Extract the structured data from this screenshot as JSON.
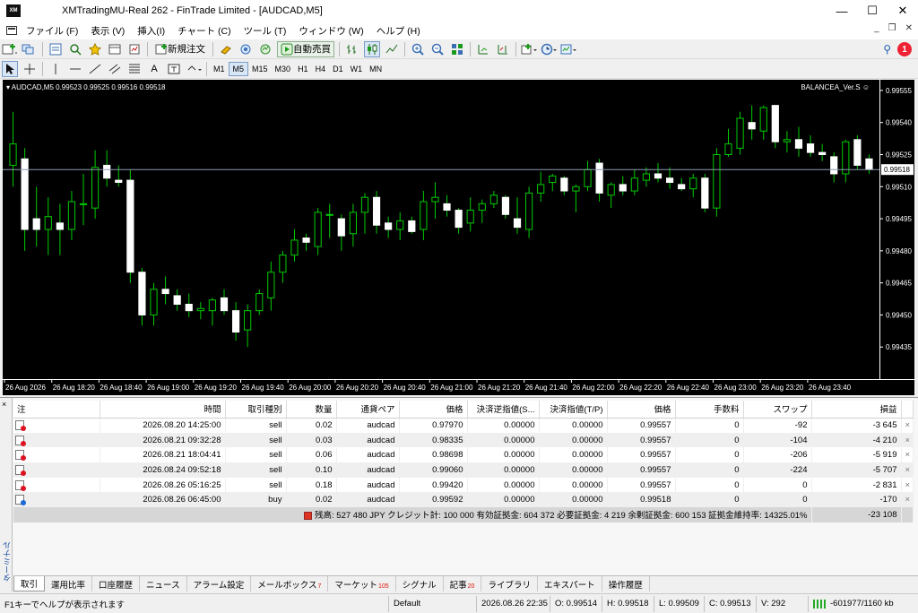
{
  "window": {
    "title": "XMTradingMU-Real 262 - FinTrade Limited - [AUDCAD,M5]",
    "logo_text": "XM",
    "controls": {
      "minimize": "—",
      "maximize": "☐",
      "close": "✕"
    }
  },
  "menu": {
    "items": [
      "ファイル (F)",
      "表示 (V)",
      "挿入(I)",
      "チャート (C)",
      "ツール (T)",
      "ウィンドウ (W)",
      "ヘルプ (H)"
    ],
    "mdi": {
      "minimize": "_",
      "restore": "❐",
      "close": "✕"
    }
  },
  "toolbar1": {
    "new_order_label": "新規注文",
    "auto_trade_label": "自動売買",
    "notification_count": "1"
  },
  "toolbar2": {
    "timeframes": [
      "M1",
      "M5",
      "M15",
      "M30",
      "H1",
      "H4",
      "D1",
      "W1",
      "MN"
    ],
    "active_timeframe": "M5"
  },
  "chart": {
    "symbol_label": "AUDCAD,M5  0.99523 0.99525 0.99516 0.99518",
    "ea_label": "BALANCEA_Ver.S ☺",
    "current_price_label": "0.99518",
    "colors": {
      "background": "#000000",
      "bull": "#00cc00",
      "bear_fill": "#ffffff",
      "wick": "#00cc00",
      "bid_line": "#8c9bb0"
    }
  },
  "chart_data": {
    "type": "candlestick",
    "symbol": "AUDCAD",
    "timeframe": "M5",
    "ylim": [
      0.9942,
      0.9956
    ],
    "y_ticks": [
      "0.99555",
      "0.99540",
      "0.99525",
      "0.99510",
      "0.99495",
      "0.99480",
      "0.99465",
      "0.99450",
      "0.99435"
    ],
    "x_ticks": [
      "26 Aug 2026",
      "26 Aug 18:20",
      "26 Aug 18:40",
      "26 Aug 19:00",
      "26 Aug 19:20",
      "26 Aug 19:40",
      "26 Aug 20:00",
      "26 Aug 20:20",
      "26 Aug 20:40",
      "26 Aug 21:00",
      "26 Aug 21:20",
      "26 Aug 21:40",
      "26 Aug 22:00",
      "26 Aug 22:20",
      "26 Aug 22:40",
      "26 Aug 23:00",
      "26 Aug 23:20",
      "26 Aug 23:40"
    ],
    "current_price": 0.99518,
    "candles": [
      {
        "o": 0.9952,
        "h": 0.99545,
        "l": 0.9951,
        "c": 0.9953
      },
      {
        "o": 0.99523,
        "h": 0.99528,
        "l": 0.9948,
        "c": 0.9949
      },
      {
        "o": 0.99495,
        "h": 0.9951,
        "l": 0.99482,
        "c": 0.9949
      },
      {
        "o": 0.9949,
        "h": 0.99505,
        "l": 0.99478,
        "c": 0.99496
      },
      {
        "o": 0.99493,
        "h": 0.99502,
        "l": 0.99478,
        "c": 0.9949
      },
      {
        "o": 0.9949,
        "h": 0.99508,
        "l": 0.99485,
        "c": 0.99503
      },
      {
        "o": 0.99502,
        "h": 0.99516,
        "l": 0.99492,
        "c": 0.99502
      },
      {
        "o": 0.995,
        "h": 0.99527,
        "l": 0.99495,
        "c": 0.99519
      },
      {
        "o": 0.9952,
        "h": 0.99527,
        "l": 0.9951,
        "c": 0.99514
      },
      {
        "o": 0.99513,
        "h": 0.9952,
        "l": 0.9951,
        "c": 0.99512
      },
      {
        "o": 0.99513,
        "h": 0.99518,
        "l": 0.99465,
        "c": 0.9947
      },
      {
        "o": 0.9947,
        "h": 0.99472,
        "l": 0.99445,
        "c": 0.9945
      },
      {
        "o": 0.9945,
        "h": 0.99465,
        "l": 0.99445,
        "c": 0.99462
      },
      {
        "o": 0.99462,
        "h": 0.99468,
        "l": 0.99455,
        "c": 0.9946
      },
      {
        "o": 0.99459,
        "h": 0.99462,
        "l": 0.99452,
        "c": 0.99455
      },
      {
        "o": 0.99455,
        "h": 0.9946,
        "l": 0.99449,
        "c": 0.99452
      },
      {
        "o": 0.99452,
        "h": 0.99456,
        "l": 0.99448,
        "c": 0.99453
      },
      {
        "o": 0.99452,
        "h": 0.99458,
        "l": 0.99445,
        "c": 0.99457
      },
      {
        "o": 0.99458,
        "h": 0.99462,
        "l": 0.9945,
        "c": 0.99452
      },
      {
        "o": 0.99452,
        "h": 0.99456,
        "l": 0.99438,
        "c": 0.99442
      },
      {
        "o": 0.99443,
        "h": 0.99455,
        "l": 0.99435,
        "c": 0.99452
      },
      {
        "o": 0.99452,
        "h": 0.99462,
        "l": 0.9945,
        "c": 0.9946
      },
      {
        "o": 0.99458,
        "h": 0.99475,
        "l": 0.99452,
        "c": 0.9947
      },
      {
        "o": 0.9947,
        "h": 0.9948,
        "l": 0.99465,
        "c": 0.99478
      },
      {
        "o": 0.99478,
        "h": 0.9949,
        "l": 0.99475,
        "c": 0.99485
      },
      {
        "o": 0.99486,
        "h": 0.99488,
        "l": 0.9948,
        "c": 0.99484
      },
      {
        "o": 0.99482,
        "h": 0.995,
        "l": 0.99478,
        "c": 0.99498
      },
      {
        "o": 0.99497,
        "h": 0.99502,
        "l": 0.99486,
        "c": 0.99497
      },
      {
        "o": 0.99495,
        "h": 0.99497,
        "l": 0.9948,
        "c": 0.99487
      },
      {
        "o": 0.99488,
        "h": 0.99502,
        "l": 0.99482,
        "c": 0.99498
      },
      {
        "o": 0.99498,
        "h": 0.99507,
        "l": 0.99488,
        "c": 0.99505
      },
      {
        "o": 0.99505,
        "h": 0.99508,
        "l": 0.99488,
        "c": 0.99492
      },
      {
        "o": 0.99493,
        "h": 0.99496,
        "l": 0.99486,
        "c": 0.9949
      },
      {
        "o": 0.9949,
        "h": 0.99498,
        "l": 0.99485,
        "c": 0.99494
      },
      {
        "o": 0.99494,
        "h": 0.99496,
        "l": 0.99488,
        "c": 0.99489
      },
      {
        "o": 0.9949,
        "h": 0.99508,
        "l": 0.99485,
        "c": 0.99503
      },
      {
        "o": 0.99503,
        "h": 0.99512,
        "l": 0.99495,
        "c": 0.99505
      },
      {
        "o": 0.99502,
        "h": 0.99506,
        "l": 0.99496,
        "c": 0.99499
      },
      {
        "o": 0.99499,
        "h": 0.995,
        "l": 0.99488,
        "c": 0.99491
      },
      {
        "o": 0.99493,
        "h": 0.99505,
        "l": 0.99489,
        "c": 0.99499
      },
      {
        "o": 0.99499,
        "h": 0.99504,
        "l": 0.99493,
        "c": 0.99502
      },
      {
        "o": 0.99502,
        "h": 0.99508,
        "l": 0.995,
        "c": 0.99506
      },
      {
        "o": 0.99505,
        "h": 0.99506,
        "l": 0.99495,
        "c": 0.99497
      },
      {
        "o": 0.99495,
        "h": 0.99505,
        "l": 0.99488,
        "c": 0.99491
      },
      {
        "o": 0.9949,
        "h": 0.9951,
        "l": 0.99486,
        "c": 0.99507
      },
      {
        "o": 0.99507,
        "h": 0.99517,
        "l": 0.99503,
        "c": 0.99511
      },
      {
        "o": 0.99512,
        "h": 0.99516,
        "l": 0.99508,
        "c": 0.99515
      },
      {
        "o": 0.99514,
        "h": 0.99515,
        "l": 0.99506,
        "c": 0.99508
      },
      {
        "o": 0.99508,
        "h": 0.99511,
        "l": 0.99498,
        "c": 0.9951
      },
      {
        "o": 0.9951,
        "h": 0.99522,
        "l": 0.99508,
        "c": 0.99518
      },
      {
        "o": 0.99521,
        "h": 0.99523,
        "l": 0.99503,
        "c": 0.99507
      },
      {
        "o": 0.99506,
        "h": 0.99512,
        "l": 0.995,
        "c": 0.99511
      },
      {
        "o": 0.99511,
        "h": 0.99515,
        "l": 0.99506,
        "c": 0.99508
      },
      {
        "o": 0.99508,
        "h": 0.99518,
        "l": 0.99506,
        "c": 0.99514
      },
      {
        "o": 0.99513,
        "h": 0.99519,
        "l": 0.9951,
        "c": 0.99516
      },
      {
        "o": 0.99516,
        "h": 0.99521,
        "l": 0.99512,
        "c": 0.99514
      },
      {
        "o": 0.99514,
        "h": 0.99519,
        "l": 0.99509,
        "c": 0.99512
      },
      {
        "o": 0.99511,
        "h": 0.99514,
        "l": 0.99508,
        "c": 0.99509
      },
      {
        "o": 0.99509,
        "h": 0.99516,
        "l": 0.99505,
        "c": 0.99514
      },
      {
        "o": 0.99514,
        "h": 0.99516,
        "l": 0.99498,
        "c": 0.995
      },
      {
        "o": 0.995,
        "h": 0.99528,
        "l": 0.99496,
        "c": 0.99525
      },
      {
        "o": 0.99525,
        "h": 0.99537,
        "l": 0.99524,
        "c": 0.9953
      },
      {
        "o": 0.99528,
        "h": 0.99545,
        "l": 0.99525,
        "c": 0.99542
      },
      {
        "o": 0.9954,
        "h": 0.99548,
        "l": 0.99532,
        "c": 0.99537
      },
      {
        "o": 0.99536,
        "h": 0.99548,
        "l": 0.99532,
        "c": 0.99547
      },
      {
        "o": 0.99548,
        "h": 0.99548,
        "l": 0.99528,
        "c": 0.99531
      },
      {
        "o": 0.99531,
        "h": 0.99536,
        "l": 0.99526,
        "c": 0.99532
      },
      {
        "o": 0.99532,
        "h": 0.99538,
        "l": 0.99524,
        "c": 0.99528
      },
      {
        "o": 0.9953,
        "h": 0.99534,
        "l": 0.99524,
        "c": 0.99526
      },
      {
        "o": 0.99526,
        "h": 0.9953,
        "l": 0.99522,
        "c": 0.99525
      },
      {
        "o": 0.99524,
        "h": 0.99526,
        "l": 0.99512,
        "c": 0.99516
      },
      {
        "o": 0.99516,
        "h": 0.99532,
        "l": 0.99512,
        "c": 0.99531
      },
      {
        "o": 0.99532,
        "h": 0.99534,
        "l": 0.99518,
        "c": 0.9952
      },
      {
        "o": 0.99523,
        "h": 0.99525,
        "l": 0.99516,
        "c": 0.99518
      }
    ]
  },
  "terminal": {
    "side_label": "ターミナル",
    "close_glyph": "×",
    "headers": [
      "注",
      "時間",
      "取引種別",
      "数量",
      "通貨ペア",
      "価格",
      "決済逆指値(S...",
      "決済指値(T/P)",
      "価格",
      "手数料",
      "スワップ",
      "損益"
    ],
    "rows": [
      {
        "type": "sell",
        "time": "2026.08.20 14:25:00",
        "side": "sell",
        "volume": "0.02",
        "symbol": "audcad",
        "open_price": "0.97970",
        "sl": "0.00000",
        "tp": "0.00000",
        "price": "0.99557",
        "commission": "0",
        "swap": "-92",
        "profit": "-3 645"
      },
      {
        "type": "sell",
        "time": "2026.08.21 09:32:28",
        "side": "sell",
        "volume": "0.03",
        "symbol": "audcad",
        "open_price": "0.98335",
        "sl": "0.00000",
        "tp": "0.00000",
        "price": "0.99557",
        "commission": "0",
        "swap": "-104",
        "profit": "-4 210"
      },
      {
        "type": "sell",
        "time": "2026.08.21 18:04:41",
        "side": "sell",
        "volume": "0.06",
        "symbol": "audcad",
        "open_price": "0.98698",
        "sl": "0.00000",
        "tp": "0.00000",
        "price": "0.99557",
        "commission": "0",
        "swap": "-206",
        "profit": "-5 919"
      },
      {
        "type": "sell",
        "time": "2026.08.24 09:52:18",
        "side": "sell",
        "volume": "0.10",
        "symbol": "audcad",
        "open_price": "0.99060",
        "sl": "0.00000",
        "tp": "0.00000",
        "price": "0.99557",
        "commission": "0",
        "swap": "-224",
        "profit": "-5 707"
      },
      {
        "type": "sell",
        "time": "2026.08.26 05:16:25",
        "side": "sell",
        "volume": "0.18",
        "symbol": "audcad",
        "open_price": "0.99420",
        "sl": "0.00000",
        "tp": "0.00000",
        "price": "0.99557",
        "commission": "0",
        "swap": "0",
        "profit": "-2 831"
      },
      {
        "type": "buy",
        "time": "2026.08.26 06:45:00",
        "side": "buy",
        "volume": "0.02",
        "symbol": "audcad",
        "open_price": "0.99592",
        "sl": "0.00000",
        "tp": "0.00000",
        "price": "0.99518",
        "commission": "0",
        "swap": "0",
        "profit": "-170"
      }
    ],
    "summary": "残高: 527 480 JPY  クレジット計: 100 000  有効証拠金: 604 372  必要証拠金: 4 219  余剰証拠金: 600 153  証拠金維持率: 14325.01%",
    "summary_profit": "-23 108",
    "tabs": [
      {
        "label": "取引",
        "badge": ""
      },
      {
        "label": "運用比率",
        "badge": ""
      },
      {
        "label": "口座履歴",
        "badge": ""
      },
      {
        "label": "ニュース",
        "badge": ""
      },
      {
        "label": "アラーム設定",
        "badge": ""
      },
      {
        "label": "メールボックス",
        "badge": "7"
      },
      {
        "label": "マーケット",
        "badge": "105"
      },
      {
        "label": "シグナル",
        "badge": ""
      },
      {
        "label": "記事",
        "badge": "20"
      },
      {
        "label": "ライブラリ",
        "badge": ""
      },
      {
        "label": "エキスパート",
        "badge": ""
      },
      {
        "label": "操作履歴",
        "badge": ""
      }
    ]
  },
  "status": {
    "help": "F1キーでヘルプが表示されます",
    "profile": "Default",
    "datetime": "2026.08.26 22:35",
    "open": "O: 0.99514",
    "high": "H: 0.99518",
    "low": "L: 0.99509",
    "close": "C: 0.99513",
    "volume": "V: 292",
    "traffic": "-601977/1160 kb"
  }
}
